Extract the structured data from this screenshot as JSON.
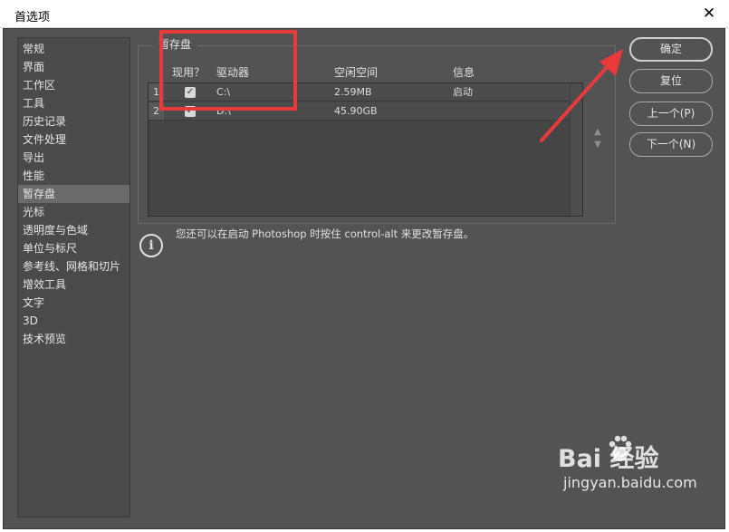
{
  "window": {
    "title": "首选项",
    "close_glyph": "✕"
  },
  "sidebar": {
    "items": [
      {
        "label": "常规"
      },
      {
        "label": "界面"
      },
      {
        "label": "工作区"
      },
      {
        "label": "工具"
      },
      {
        "label": "历史记录"
      },
      {
        "label": "文件处理"
      },
      {
        "label": "导出"
      },
      {
        "label": "性能"
      },
      {
        "label": "暂存盘",
        "selected": true
      },
      {
        "label": "光标"
      },
      {
        "label": "透明度与色域"
      },
      {
        "label": "单位与标尺"
      },
      {
        "label": "参考线、网格和切片"
      },
      {
        "label": "增效工具"
      },
      {
        "label": "文字"
      },
      {
        "label": "3D"
      },
      {
        "label": "技术预览"
      }
    ]
  },
  "scratch": {
    "legend": "暂存盘",
    "columns": {
      "active": "现用？",
      "drive": "驱动器",
      "free": "空闲空间",
      "info": "信息"
    },
    "rows": [
      {
        "num": "1",
        "checked": true,
        "drive": "C:\\",
        "free": "2.59MB",
        "info": "启动"
      },
      {
        "num": "2",
        "checked": true,
        "drive": "D:\\",
        "free": "45.90GB",
        "info": ""
      }
    ],
    "move_up": "▲",
    "move_down": "▼"
  },
  "info": {
    "icon": "info-icon",
    "icon_glyph": "i",
    "text": "您还可以在启动 Photoshop 时按住 control-alt 来更改暂存盘。"
  },
  "buttons": {
    "ok": "确定",
    "reset": "复位",
    "prev": "上一个(P)",
    "next": "下一个(N)"
  },
  "annotation": {
    "color": "#e8393b"
  },
  "watermark": {
    "brand": "Bai  经验",
    "url": "jingyan.baidu.com"
  }
}
